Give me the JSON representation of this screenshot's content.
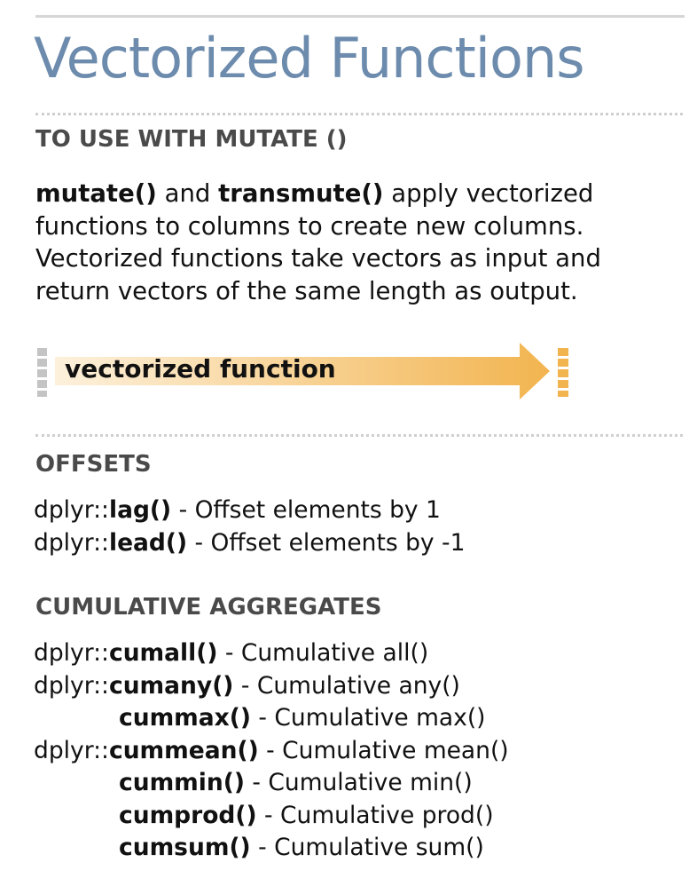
{
  "title": "Vectorized Functions",
  "sections": {
    "mutate": {
      "heading": "TO USE WITH MUTATE ()",
      "intro": {
        "fn1": "mutate()",
        "text1": " and ",
        "fn2": "transmute()",
        "text2": " apply vectorized functions to columns to create new columns. Vectorized functions take vectors as input and return vectors of the same length as output."
      },
      "diagram_label": "vectorized function"
    },
    "offsets": {
      "heading": "OFFSETS",
      "items": [
        {
          "prefix": "dplyr::",
          "fn": "lag()",
          "desc": " - Offset elements by 1"
        },
        {
          "prefix": "dplyr::",
          "fn": "lead()",
          "desc": " - Offset elements by -1"
        }
      ]
    },
    "cumulative": {
      "heading": "CUMULATIVE AGGREGATES",
      "items": [
        {
          "prefix": "dplyr::",
          "fn": "cumall()",
          "desc": " - Cumulative all()"
        },
        {
          "prefix": "dplyr::",
          "fn": "cumany()",
          "desc": " - Cumulative any()"
        },
        {
          "prefix": "",
          "fn": "cummax()",
          "desc": " - Cumulative max()"
        },
        {
          "prefix": "dplyr::",
          "fn": "cummean()",
          "desc": " - Cumulative mean()"
        },
        {
          "prefix": "",
          "fn": "cummin()",
          "desc": " - Cumulative min()"
        },
        {
          "prefix": "",
          "fn": "cumprod()",
          "desc": " - Cumulative prod()"
        },
        {
          "prefix": "",
          "fn": "cumsum()",
          "desc": " - Cumulative sum()"
        }
      ]
    }
  },
  "colors": {
    "title": "#6c8bad",
    "heading": "#4a4a4a",
    "arrow_start": "#fdf1dc",
    "arrow_end": "#f2b44f",
    "input_column": "#c4c4c4",
    "output_column": "#f2b44f"
  }
}
